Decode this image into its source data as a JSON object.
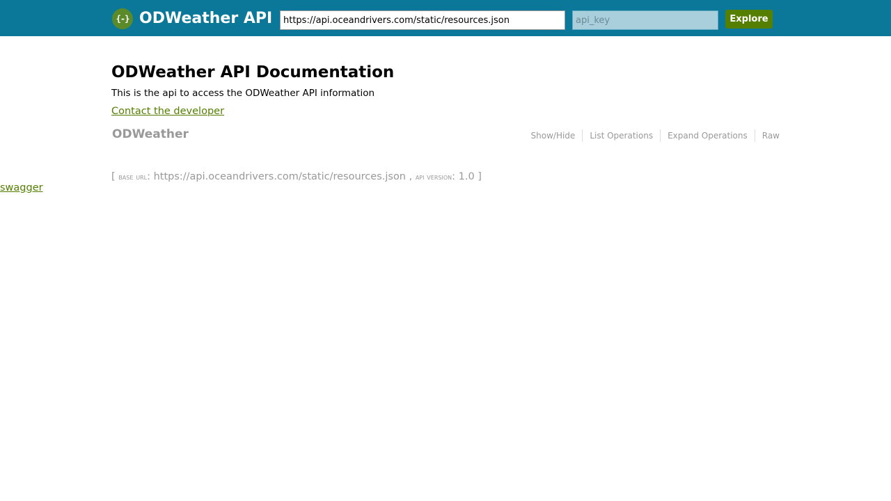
{
  "header": {
    "logo_icon_text": "{-}",
    "title": "ODWeather API",
    "url_value": "https://api.oceandrivers.com/static/resources.json",
    "api_key_placeholder": "api_key",
    "explore_label": "Explore",
    "background_color": "#0b7899",
    "accent_color": "#547f00"
  },
  "info": {
    "title": "ODWeather API Documentation",
    "description": "This is the api to access the ODWeather API information",
    "contact_label": "Contact the developer"
  },
  "resource": {
    "name": "ODWeather",
    "operations": [
      "Show/Hide",
      "List Operations",
      "Expand Operations",
      "Raw"
    ]
  },
  "footer": {
    "base_url_label": "base url",
    "base_url_value": "https://api.oceandrivers.com/static/resources.json",
    "api_version_label": "api version",
    "api_version_value": "1.0"
  },
  "swagger_link": "swagger"
}
